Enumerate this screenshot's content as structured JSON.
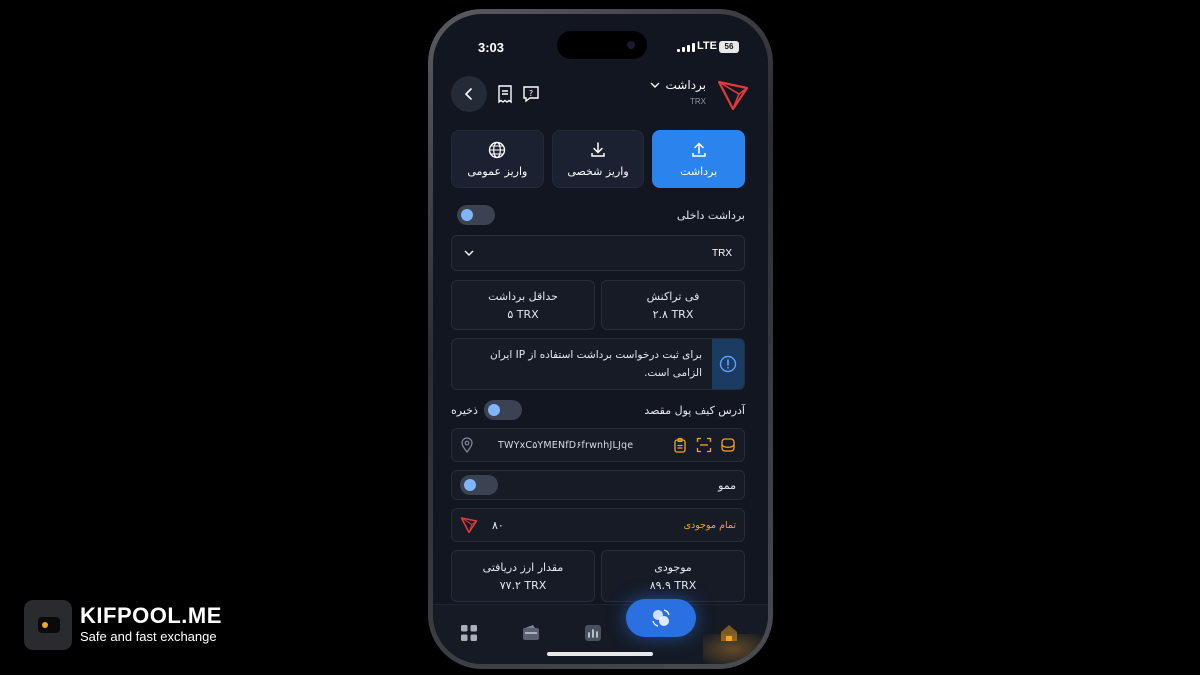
{
  "status": {
    "time": "3:03",
    "network": "LTE",
    "battery": "56"
  },
  "header": {
    "title": "برداشت",
    "subtitle": "TRX"
  },
  "tabs": [
    {
      "label": "برداشت",
      "icon": "upload-icon",
      "active": true
    },
    {
      "label": "واریز شخصی",
      "icon": "download-icon",
      "active": false
    },
    {
      "label": "واریز عمومی",
      "icon": "globe-icon",
      "active": false
    }
  ],
  "internal_withdraw": {
    "label": "برداشت داخلی"
  },
  "network_select": {
    "value": "TRX"
  },
  "fees": {
    "tx_fee": {
      "label": "فی تراکنش",
      "value": "۲.۸ TRX"
    },
    "min_withdraw": {
      "label": "حداقل برداشت",
      "value": "۵ TRX"
    }
  },
  "notice": {
    "text": "برای ثبت درخواست برداشت استفاده از IP ایران الزامی است."
  },
  "destination": {
    "label": "آدرس کیف پول مقصد",
    "save_label": "ذخیره",
    "address": "TWYxC۵YMENfD۶frwnhJLJqe"
  },
  "memo": {
    "label": "ممو"
  },
  "amount": {
    "value": "۸۰",
    "all_label": "تمام موجودی"
  },
  "summary": {
    "balance": {
      "label": "موجودی",
      "value": "۸۹.۹ TRX"
    },
    "received": {
      "label": "مقدار ارز دریافتی",
      "value": "۷۷.۲ TRX"
    }
  },
  "brand": {
    "name": "KIFPOOL.ME",
    "tagline": "Safe and fast exchange"
  },
  "colors": {
    "accent": "#2b84ee",
    "tron_red": "#e23a3a",
    "warning": "#f3a42c",
    "bg": "#121620"
  }
}
